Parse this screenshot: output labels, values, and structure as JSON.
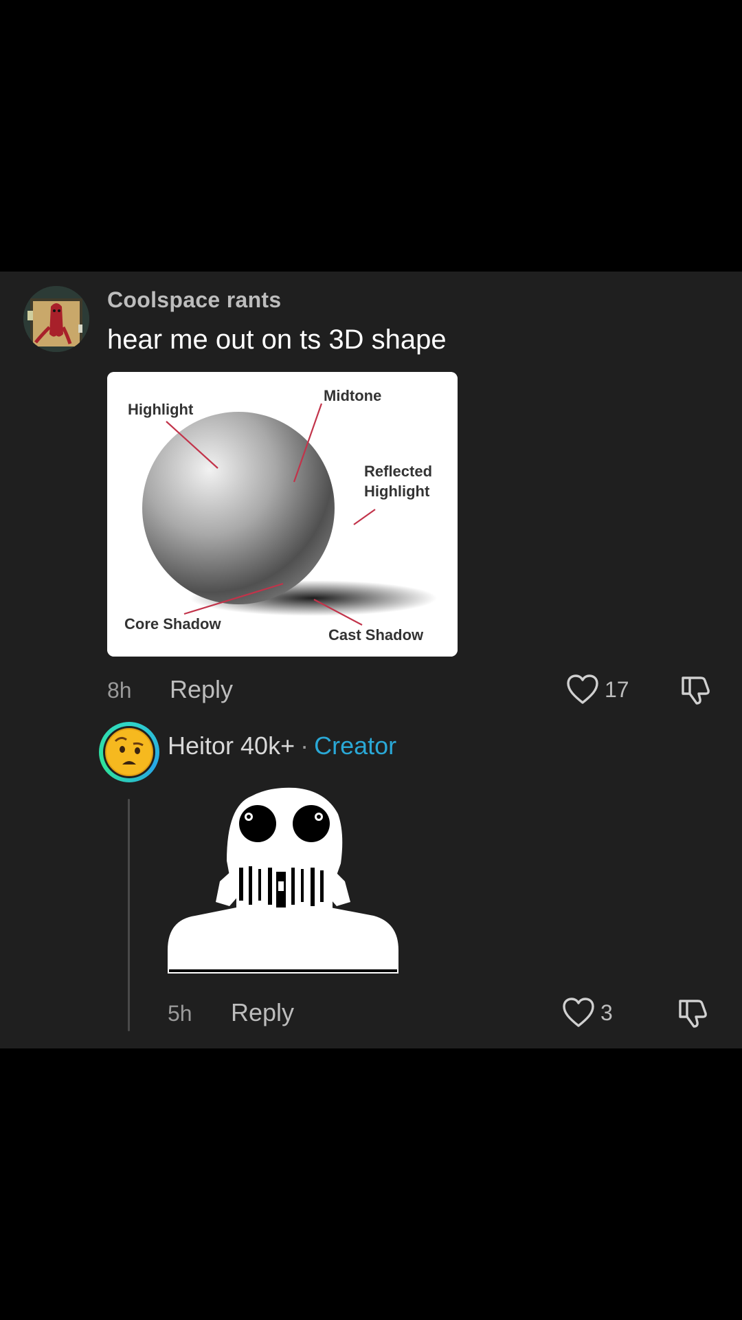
{
  "comment": {
    "username": "Coolspace rants",
    "text": "hear me out on ts 3D shape",
    "image_labels": {
      "highlight": "Highlight",
      "midtone": "Midtone",
      "reflected_1": "Reflected",
      "reflected_2": "Highlight",
      "core_shadow": "Core Shadow",
      "cast_shadow": "Cast Shadow"
    },
    "time": "8h",
    "reply_label": "Reply",
    "likes": "17"
  },
  "reply": {
    "username": "Heitor 40k+",
    "separator": "·",
    "badge": "Creator",
    "time": "5h",
    "reply_label": "Reply",
    "likes": "3"
  },
  "icons": {
    "like": "heart-outline-icon",
    "dislike": "thumbs-down-outline-icon"
  },
  "colors": {
    "panel_bg": "#1f1f1f",
    "creator_accent": "#2aa8d6",
    "label_line": "#c2334a"
  }
}
